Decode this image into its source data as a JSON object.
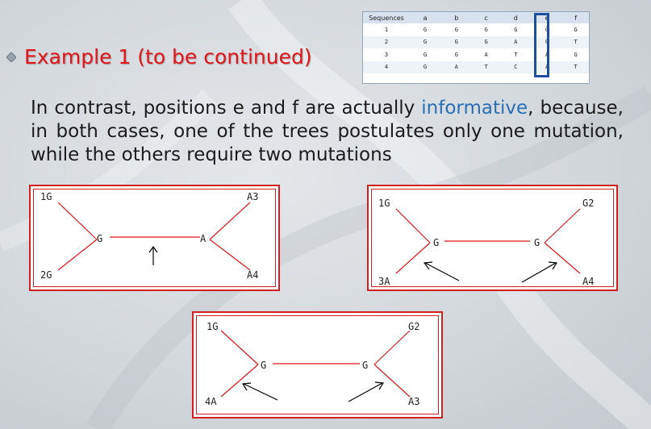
{
  "title": "Example 1 (to be continued)",
  "paragraph": {
    "part1": "In contrast, positions e and f are actually ",
    "highlight": "informative",
    "part2": ", because, in both cases, one of the trees postulates only one mutation, while the others require two mutations"
  },
  "sequence_table": {
    "headers": [
      "Sequences",
      "a",
      "b",
      "c",
      "d",
      "e",
      "f"
    ],
    "rows": [
      [
        "1",
        "G",
        "G",
        "G",
        "G",
        "G",
        "G"
      ],
      [
        "2",
        "G",
        "G",
        "G",
        "A",
        "G",
        "T"
      ],
      [
        "3",
        "G",
        "G",
        "A",
        "T",
        "A",
        "G"
      ],
      [
        "4",
        "G",
        "A",
        "T",
        "C",
        "A",
        "T"
      ]
    ],
    "highlighted_column": "e"
  },
  "trees": [
    {
      "leaf_tl": "1G",
      "leaf_bl": "2G",
      "leaf_tr": "A3",
      "leaf_br": "A4",
      "node_left": "G",
      "node_right": "A"
    },
    {
      "leaf_tl": "1G",
      "leaf_bl": "3A",
      "leaf_tr": "G2",
      "leaf_br": "A4",
      "node_left": "G",
      "node_right": "G"
    },
    {
      "leaf_tl": "1G",
      "leaf_bl": "4A",
      "leaf_tr": "G2",
      "leaf_br": "A3",
      "node_left": "G",
      "node_right": "G"
    }
  ],
  "colors": {
    "title": "#e0161b",
    "tree_line": "#e0161b",
    "highlight_text": "#2a6fb5",
    "column_box": "#1e4f9c"
  }
}
